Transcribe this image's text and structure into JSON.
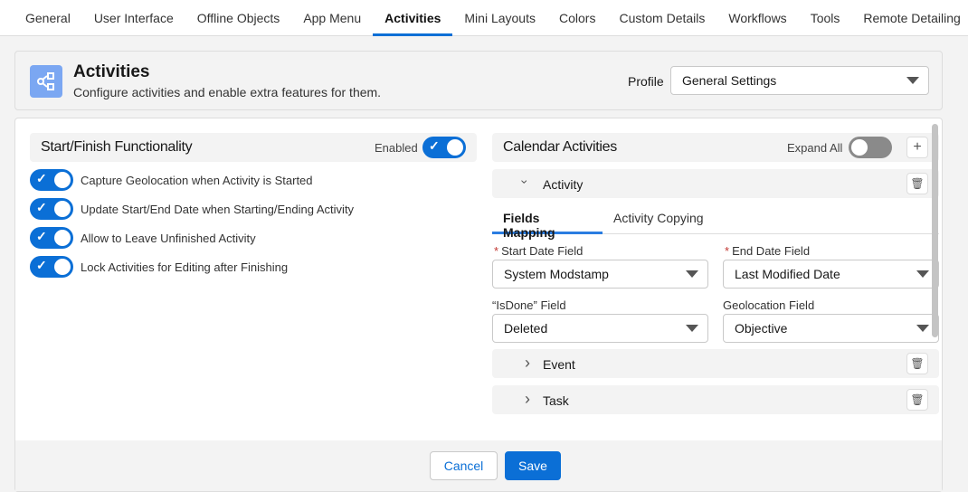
{
  "tabs": [
    "General",
    "User Interface",
    "Offline Objects",
    "App Menu",
    "Activities",
    "Mini Layouts",
    "Colors",
    "Custom Details",
    "Workflows",
    "Tools",
    "Remote Detailing"
  ],
  "header": {
    "title": "Activities",
    "subtitle": "Configure activities and enable extra features for them.",
    "profile_label": "Profile",
    "profile_value": "General Settings"
  },
  "left": {
    "title": "Start/Finish Functionality",
    "enabled_label": "Enabled",
    "options": [
      "Capture Geolocation when Activity is Started",
      "Update Start/End Date when Starting/Ending Activity",
      "Allow to Leave Unfinished Activity",
      "Lock Activities for Editing after Finishing"
    ]
  },
  "right": {
    "title": "Calendar Activities",
    "expand_all": "Expand All",
    "activity": "Activity",
    "subtabs": [
      "Fields Mapping",
      "Activity Copying"
    ],
    "fields": {
      "start_label": "Start Date Field",
      "start_value": "System Modstamp",
      "end_label": "End Date Field",
      "end_value": "Last Modified Date",
      "isdone_label": "“IsDone” Field",
      "isdone_value": "Deleted",
      "geo_label": "Geolocation Field",
      "geo_value": "Objective"
    },
    "event": "Event",
    "task": "Task"
  },
  "footer": {
    "cancel": "Cancel",
    "save": "Save"
  },
  "colors": {
    "accent": "#0b6fd6",
    "icon_bg": "#7ba7f2"
  }
}
